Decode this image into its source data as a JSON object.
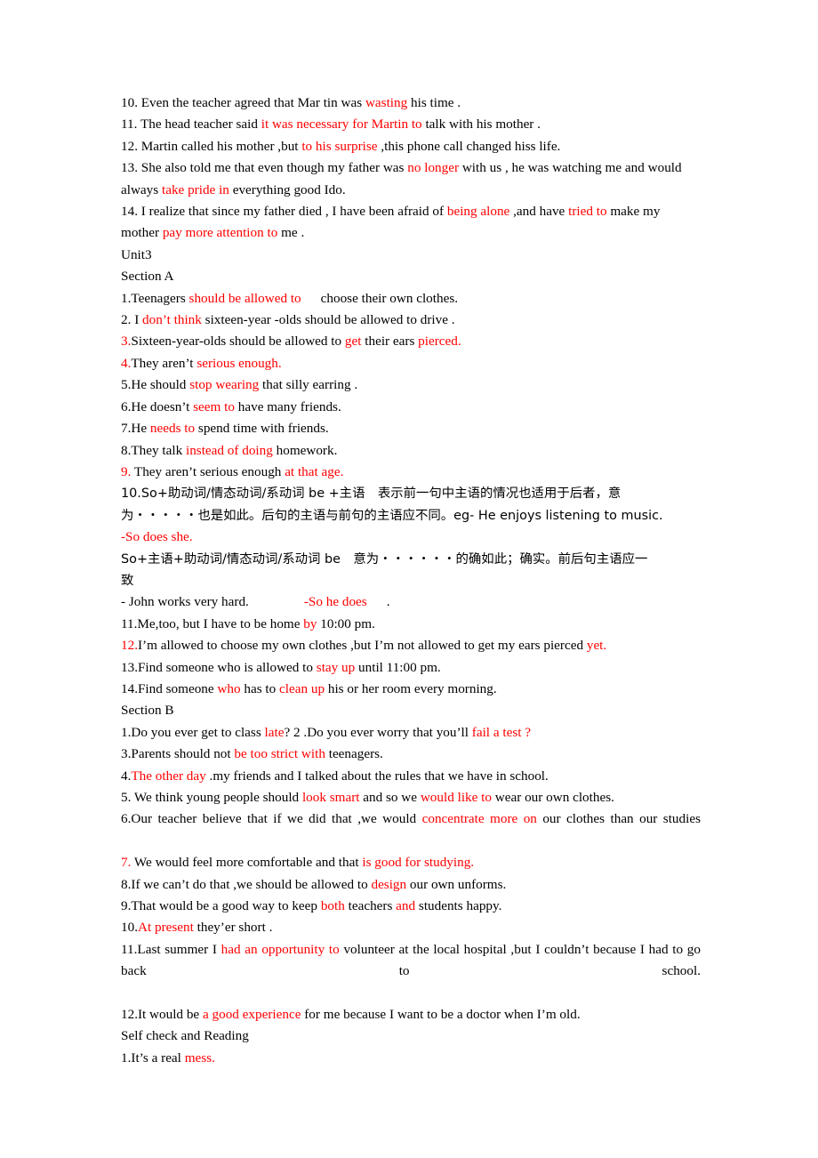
{
  "document": {
    "title": "Unit3 Section A / Section B / Self check and Reading answer key",
    "accent_color": "#ff0000",
    "text_color": "#000000",
    "background_color": "#ffffff"
  },
  "headings": {
    "unit": "Unit3",
    "section_a": "Section A",
    "section_b": "Section B",
    "self_check": "Self check and Reading"
  },
  "intro_items": [
    {
      "number": "10.",
      "parts": [
        {
          "text": " Even the teacher agreed that Mar tin was ",
          "red": false
        },
        {
          "text": "wasting",
          "red": true
        },
        {
          "text": " his time .",
          "red": false
        }
      ]
    },
    {
      "number": "11.",
      "parts": [
        {
          "text": " The head teacher said ",
          "red": false
        },
        {
          "text": "it was necessary for Martin to",
          "red": true
        },
        {
          "text": " talk with his mother .",
          "red": false
        }
      ]
    },
    {
      "number": "12.",
      "parts": [
        {
          "text": " Martin called his mother ,but ",
          "red": false
        },
        {
          "text": "to his surprise",
          "red": true
        },
        {
          "text": " ,this phone call changed hiss life.",
          "red": false
        }
      ]
    },
    {
      "number": "13.",
      "parts": [
        {
          "text": " She also told me that even though my father was ",
          "red": false
        },
        {
          "text": "no longer",
          "red": true
        },
        {
          "text": " with us , he was watching me and would always ",
          "red": false
        },
        {
          "text": "take pride in",
          "red": true
        },
        {
          "text": " everything good Ido.",
          "red": false
        }
      ]
    },
    {
      "number": "14.",
      "parts": [
        {
          "text": " I realize that since my father died , I have been afraid of ",
          "red": false
        },
        {
          "text": "being alone",
          "red": true
        },
        {
          "text": " ,and have ",
          "red": false
        },
        {
          "text": "tried to",
          "red": true
        },
        {
          "text": " make my",
          "red": false
        },
        {
          "text": "GAP_SM",
          "red": false
        },
        {
          "text": "mother ",
          "red": false
        },
        {
          "text": "pay more attention to",
          "red": true
        },
        {
          "text": " me .",
          "red": false
        }
      ]
    }
  ],
  "section_a_items": [
    {
      "number": "1.",
      "number_red": false,
      "parts": [
        {
          "text": "Teenagers ",
          "red": false
        },
        {
          "text": "should be allowed to",
          "red": true
        },
        {
          "text": "GAP_MD",
          "red": false
        },
        {
          "text": "choose their own clothes.",
          "red": false
        }
      ]
    },
    {
      "number": "2.",
      "number_red": false,
      "parts": [
        {
          "text": " I ",
          "red": false
        },
        {
          "text": "don’t think",
          "red": true
        },
        {
          "text": " sixteen-year -olds should be allowed to drive .",
          "red": false
        }
      ]
    },
    {
      "number": "3.",
      "number_red": true,
      "parts": [
        {
          "text": "Sixteen-year-olds should be allowed to ",
          "red": false
        },
        {
          "text": "get",
          "red": true
        },
        {
          "text": " their ears ",
          "red": false
        },
        {
          "text": "pierced.",
          "red": true
        }
      ]
    },
    {
      "number": "4.",
      "number_red": true,
      "parts": [
        {
          "text": "They aren’t ",
          "red": false
        },
        {
          "text": "serious enough.",
          "red": true
        }
      ]
    },
    {
      "number": "5.",
      "number_red": false,
      "parts": [
        {
          "text": "He should ",
          "red": false
        },
        {
          "text": "stop wearing",
          "red": true
        },
        {
          "text": " that silly earring .",
          "red": false
        }
      ]
    },
    {
      "number": "6.",
      "number_red": false,
      "parts": [
        {
          "text": "He doesn’t ",
          "red": false
        },
        {
          "text": "seem to",
          "red": true
        },
        {
          "text": " have many friends.",
          "red": false
        }
      ]
    },
    {
      "number": "7.",
      "number_red": false,
      "parts": [
        {
          "text": "He ",
          "red": false
        },
        {
          "text": "needs to",
          "red": true
        },
        {
          "text": " spend time with friends.",
          "red": false
        }
      ]
    },
    {
      "number": "8.",
      "number_red": false,
      "parts": [
        {
          "text": "They talk ",
          "red": false
        },
        {
          "text": "instead of doing",
          "red": true
        },
        {
          "text": " homework.",
          "red": false
        }
      ]
    },
    {
      "number": "9.",
      "number_red": true,
      "parts": [
        {
          "text": " They aren’t serious enough ",
          "red": false
        },
        {
          "text": "at that age.",
          "red": true
        }
      ]
    }
  ],
  "grammar_note": {
    "rule1_line1": "10.So+助动词/情态动词/系动词 be +主语　表示前一句中主语的情况也适用于后者，意",
    "rule1_line2": "为・・・・・也是如此。后句的主语与前句的主语应不同。eg- He enjoys listening to music.",
    "rule1_answer": "-So does she.",
    "rule2_line1": "So+主语+助动词/情态动词/系动词 be　意为・・・・・・的确如此；确实。前后句主语应一",
    "rule2_line2": "致",
    "example_prompt": "- John works very hard.",
    "example_answer": "-So he does",
    "example_period": "."
  },
  "section_a_items_cont": [
    {
      "number": "11.",
      "number_red": false,
      "parts": [
        {
          "text": "Me,too, but I have to be home ",
          "red": false
        },
        {
          "text": "by",
          "red": true
        },
        {
          "text": " 10:00 pm.",
          "red": false
        }
      ]
    },
    {
      "number": "12.",
      "number_red": true,
      "parts": [
        {
          "text": "I’m allowed to choose my own clothes ,but I’m not allowed to get my ears pierced ",
          "red": false
        },
        {
          "text": "yet.",
          "red": true
        }
      ]
    },
    {
      "number": "13.",
      "number_red": false,
      "parts": [
        {
          "text": "Find someone who is allowed to ",
          "red": false
        },
        {
          "text": "stay up",
          "red": true
        },
        {
          "text": " until 11:00 pm.",
          "red": false
        }
      ]
    },
    {
      "number": "14.",
      "number_red": false,
      "parts": [
        {
          "text": "Find someone ",
          "red": false
        },
        {
          "text": "who",
          "red": true
        },
        {
          "text": " has to ",
          "red": false
        },
        {
          "text": "clean up",
          "red": true
        },
        {
          "text": " his or her room every morning.",
          "red": false
        }
      ]
    }
  ],
  "section_b_items": [
    {
      "number": "1.",
      "number_red": false,
      "parts": [
        {
          "text": "Do you ever get to class ",
          "red": false
        },
        {
          "text": "late",
          "red": true
        },
        {
          "text": "? 2 .Do you ever worry that you’ll ",
          "red": false
        },
        {
          "text": "fail a test ?",
          "red": true
        }
      ]
    },
    {
      "number": "3.",
      "number_red": false,
      "parts": [
        {
          "text": "Parents should not ",
          "red": false
        },
        {
          "text": "be too strict with",
          "red": true
        },
        {
          "text": " teenagers.",
          "red": false
        }
      ]
    },
    {
      "number": "4.",
      "number_red": false,
      "parts": [
        {
          "text": "The other day",
          "red": true
        },
        {
          "text": " .my friends and I talked about the rules that we have in school.",
          "red": false
        }
      ]
    },
    {
      "number": "5.",
      "number_red": false,
      "parts": [
        {
          "text": " We think young people should ",
          "red": false
        },
        {
          "text": "look smart",
          "red": true
        },
        {
          "text": " and so we ",
          "red": false
        },
        {
          "text": "would like to",
          "red": true
        },
        {
          "text": " wear our own clothes.",
          "red": false
        }
      ]
    },
    {
      "number": "6.",
      "number_red": false,
      "justify": true,
      "parts": [
        {
          "text": "Our teacher believe that if we did that ,we would ",
          "red": false
        },
        {
          "text": "concentrate more on",
          "red": true
        },
        {
          "text": " our clothes than our studies",
          "red": false
        }
      ]
    },
    {
      "number": "7.",
      "number_red": true,
      "parts": [
        {
          "text": " We would feel more comfortable and that ",
          "red": false
        },
        {
          "text": "is good for studying.",
          "red": true
        }
      ]
    },
    {
      "number": "8.",
      "number_red": false,
      "parts": [
        {
          "text": "If we can’t do that ,we should be allowed to ",
          "red": false
        },
        {
          "text": "design",
          "red": true
        },
        {
          "text": " our own unforms.",
          "red": false
        }
      ]
    },
    {
      "number": "9.",
      "number_red": false,
      "parts": [
        {
          "text": "That would be a good way to keep ",
          "red": false
        },
        {
          "text": "both",
          "red": true
        },
        {
          "text": " teachers ",
          "red": false
        },
        {
          "text": "and",
          "red": true
        },
        {
          "text": " students happy.",
          "red": false
        }
      ]
    },
    {
      "number": "10.",
      "number_red": false,
      "parts": [
        {
          "text": "At present",
          "red": true
        },
        {
          "text": " they’er short .",
          "red": false
        }
      ]
    },
    {
      "number": "11.",
      "number_red": false,
      "justify": true,
      "parts": [
        {
          "text": "Last summer I ",
          "red": false
        },
        {
          "text": "had an opportunity to",
          "red": true
        },
        {
          "text": " volunteer at the local hospital ,but I couldn’t because I had to go back to school.",
          "red": false
        }
      ]
    },
    {
      "number": "12.",
      "number_red": false,
      "parts": [
        {
          "text": "It would be ",
          "red": false
        },
        {
          "text": "a good experience",
          "red": true
        },
        {
          "text": " for me because I want to be a doctor when I’m old.",
          "red": false
        }
      ]
    }
  ],
  "self_check_items": [
    {
      "number": "1.",
      "number_red": false,
      "parts": [
        {
          "text": "It’s a real ",
          "red": false
        },
        {
          "text": "mess.",
          "red": true
        }
      ]
    }
  ]
}
